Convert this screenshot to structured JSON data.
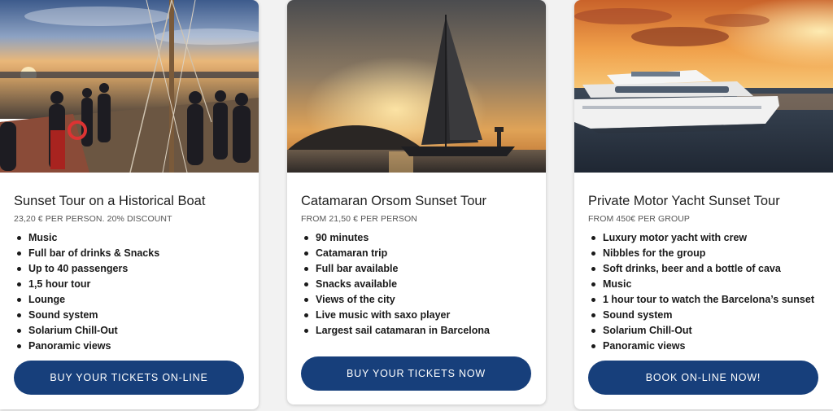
{
  "cards": [
    {
      "title": "Sunset Tour on a Historical Boat",
      "price": "23,20 € PER PERSON. 20% DISCOUNT",
      "features": [
        "Music",
        "Full bar of drinks & Snacks",
        "Up to 40 passengers",
        "1,5 hour tour",
        "Lounge",
        "Sound system",
        "Solarium Chill-Out",
        "Panoramic views"
      ],
      "button": "BUY YOUR TICKETS ON-LINE"
    },
    {
      "title": "Catamaran Orsom Sunset Tour",
      "price": "FROM 21,50 € PER PERSON",
      "features": [
        "90 minutes",
        "Catamaran trip",
        "Full bar available",
        "Snacks available",
        "Views of the city",
        "Live music with saxo player",
        "Largest sail catamaran in Barcelona"
      ],
      "button": "BUY YOUR TICKETS NOW"
    },
    {
      "title": "Private Motor Yacht Sunset Tour",
      "price": "FROM 450€ PER GROUP",
      "features": [
        "Luxury motor yacht with crew",
        "Nibbles for the group",
        "Soft drinks, beer and a bottle of cava",
        "Music",
        "1 hour tour to watch the Barcelona’s sunset",
        "Sound system",
        "Solarium Chill-Out",
        "Panoramic views"
      ],
      "button": "BOOK ON-LINE NOW!"
    }
  ],
  "colors": {
    "button_bg": "#173f7b",
    "button_text": "#ffffff",
    "card_bg": "#ffffff",
    "page_bg": "#f2f2f2"
  }
}
